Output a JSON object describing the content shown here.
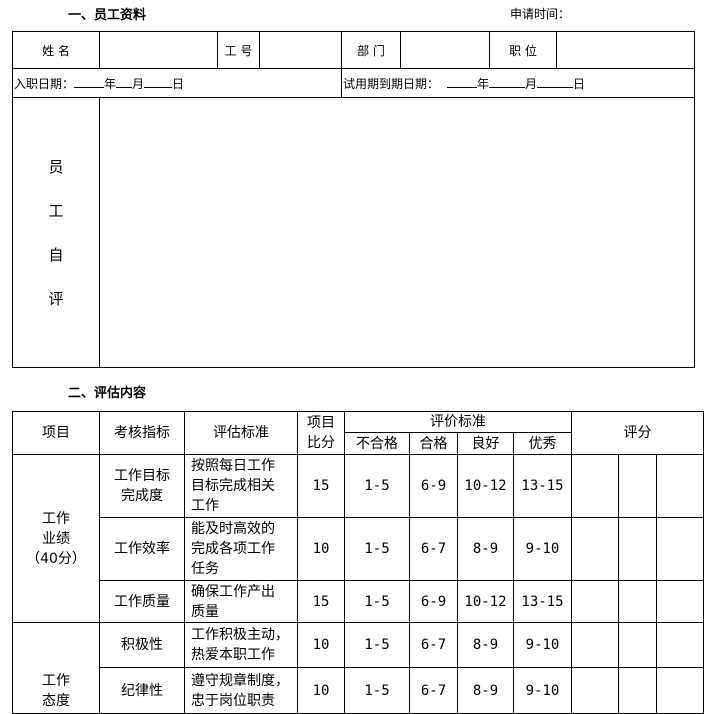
{
  "section1": {
    "title": "一、员工资料",
    "apply_time_label": "申请时间："
  },
  "info_table": {
    "name_label": "姓 名",
    "name_value": "",
    "id_label": "工 号",
    "id_value": "",
    "dept_label": "部 门",
    "dept_value": "",
    "position_label": "职 位",
    "position_value": "",
    "hire_date_label": "入职日期：",
    "probation_end_label": "试用期到期日期：",
    "year": "年",
    "month": "月",
    "day": "日",
    "self_eval_label": [
      "员",
      "工",
      "自",
      "评"
    ],
    "self_eval_value": ""
  },
  "section2": {
    "title": "二、评估内容"
  },
  "eval_table": {
    "headers": {
      "item": "项目",
      "indicator": "考核指标",
      "criteria": "评估标准",
      "weight_line1": "项目",
      "weight_line2": "比分",
      "rating_standard": "评价标准",
      "fail": "不合格",
      "pass": "合格",
      "good": "良好",
      "excellent": "优秀",
      "score": "评分"
    },
    "groups": [
      {
        "name_line1": "工作",
        "name_line2": "业绩",
        "name_line3": "（40分）",
        "rows": [
          {
            "indicator_line1": "工作目标",
            "indicator_line2": "完成度",
            "criteria_lines": [
              "按照每日工作",
              "目标完成相关",
              "工作"
            ],
            "weight": "15",
            "fail": "1-5",
            "pass": "6-9",
            "good": "10-12",
            "excellent": "13-15"
          },
          {
            "indicator_line1": "工作效率",
            "indicator_line2": "",
            "criteria_lines": [
              "能及时高效的",
              "完成各项工作",
              "任务"
            ],
            "weight": "10",
            "fail": "1-5",
            "pass": "6-7",
            "good": "8-9",
            "excellent": "9-10"
          },
          {
            "indicator_line1": "工作质量",
            "indicator_line2": "",
            "criteria_lines": [
              "确保工作产出",
              "质量"
            ],
            "weight": "15",
            "fail": "1-5",
            "pass": "6-9",
            "good": "10-12",
            "excellent": "13-15"
          }
        ]
      },
      {
        "name_line1": "工作",
        "name_line2": "态度",
        "rows": [
          {
            "indicator_line1": "积极性",
            "indicator_line2": "",
            "criteria_lines": [
              "工作积极主动，",
              "热爱本职工作"
            ],
            "weight": "10",
            "fail": "1-5",
            "pass": "6-7",
            "good": "8-9",
            "excellent": "9-10"
          },
          {
            "indicator_line1": "纪律性",
            "indicator_line2": "",
            "criteria_lines": [
              "遵守规章制度，",
              "忠于岗位职责"
            ],
            "weight": "10",
            "fail": "1-5",
            "pass": "6-7",
            "good": "8-9",
            "excellent": "9-10"
          }
        ]
      }
    ]
  }
}
